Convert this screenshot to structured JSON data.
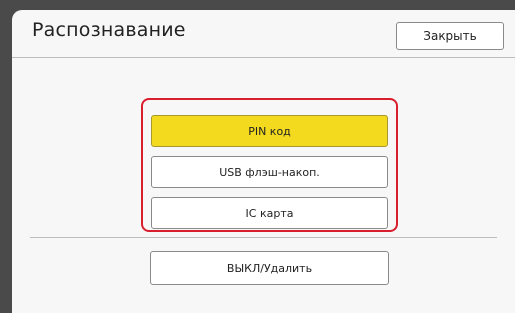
{
  "header": {
    "title": "Распознавание",
    "close_label": "Закрыть"
  },
  "auth_options": {
    "pin_label": "PIN код",
    "usb_label": "USB флэш-накоп.",
    "ic_label": "IC карта",
    "selected": "PIN код"
  },
  "footer": {
    "off_delete_label": "ВЫКЛ/Удалить"
  },
  "colors": {
    "selected_fill": "#f3da1f",
    "group_border": "#d91e2e"
  }
}
